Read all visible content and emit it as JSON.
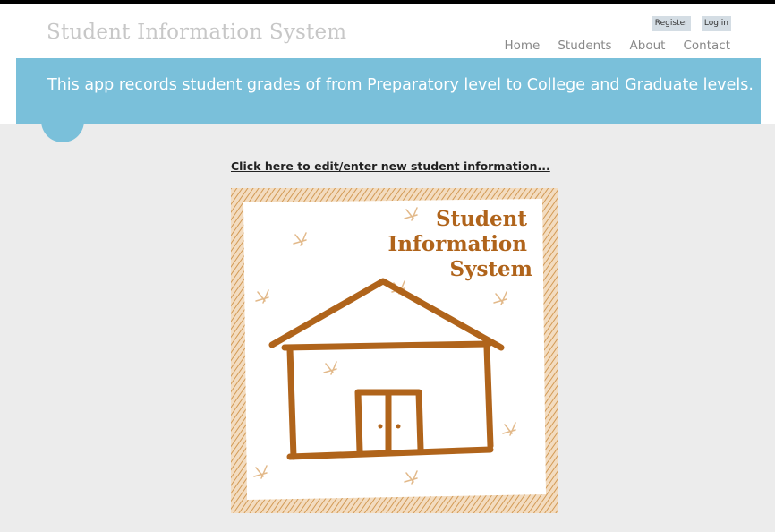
{
  "header": {
    "site_title": "Student Information System",
    "auth": {
      "register": "Register",
      "login": "Log in"
    },
    "nav": [
      {
        "label": "Home"
      },
      {
        "label": "Students"
      },
      {
        "label": "About"
      },
      {
        "label": "Contact"
      }
    ]
  },
  "banner": {
    "text": "This app records student grades of from Preparatory level to College and Graduate levels."
  },
  "main": {
    "edit_link": "Click here to edit/enter new student information..."
  },
  "logo_image": {
    "lines": [
      "Student",
      "Information",
      "System"
    ]
  },
  "colors": {
    "banner": "#7ac0da",
    "background": "#ececec",
    "logo_brown": "#b0641b",
    "logo_frame": "#d9a35b"
  }
}
